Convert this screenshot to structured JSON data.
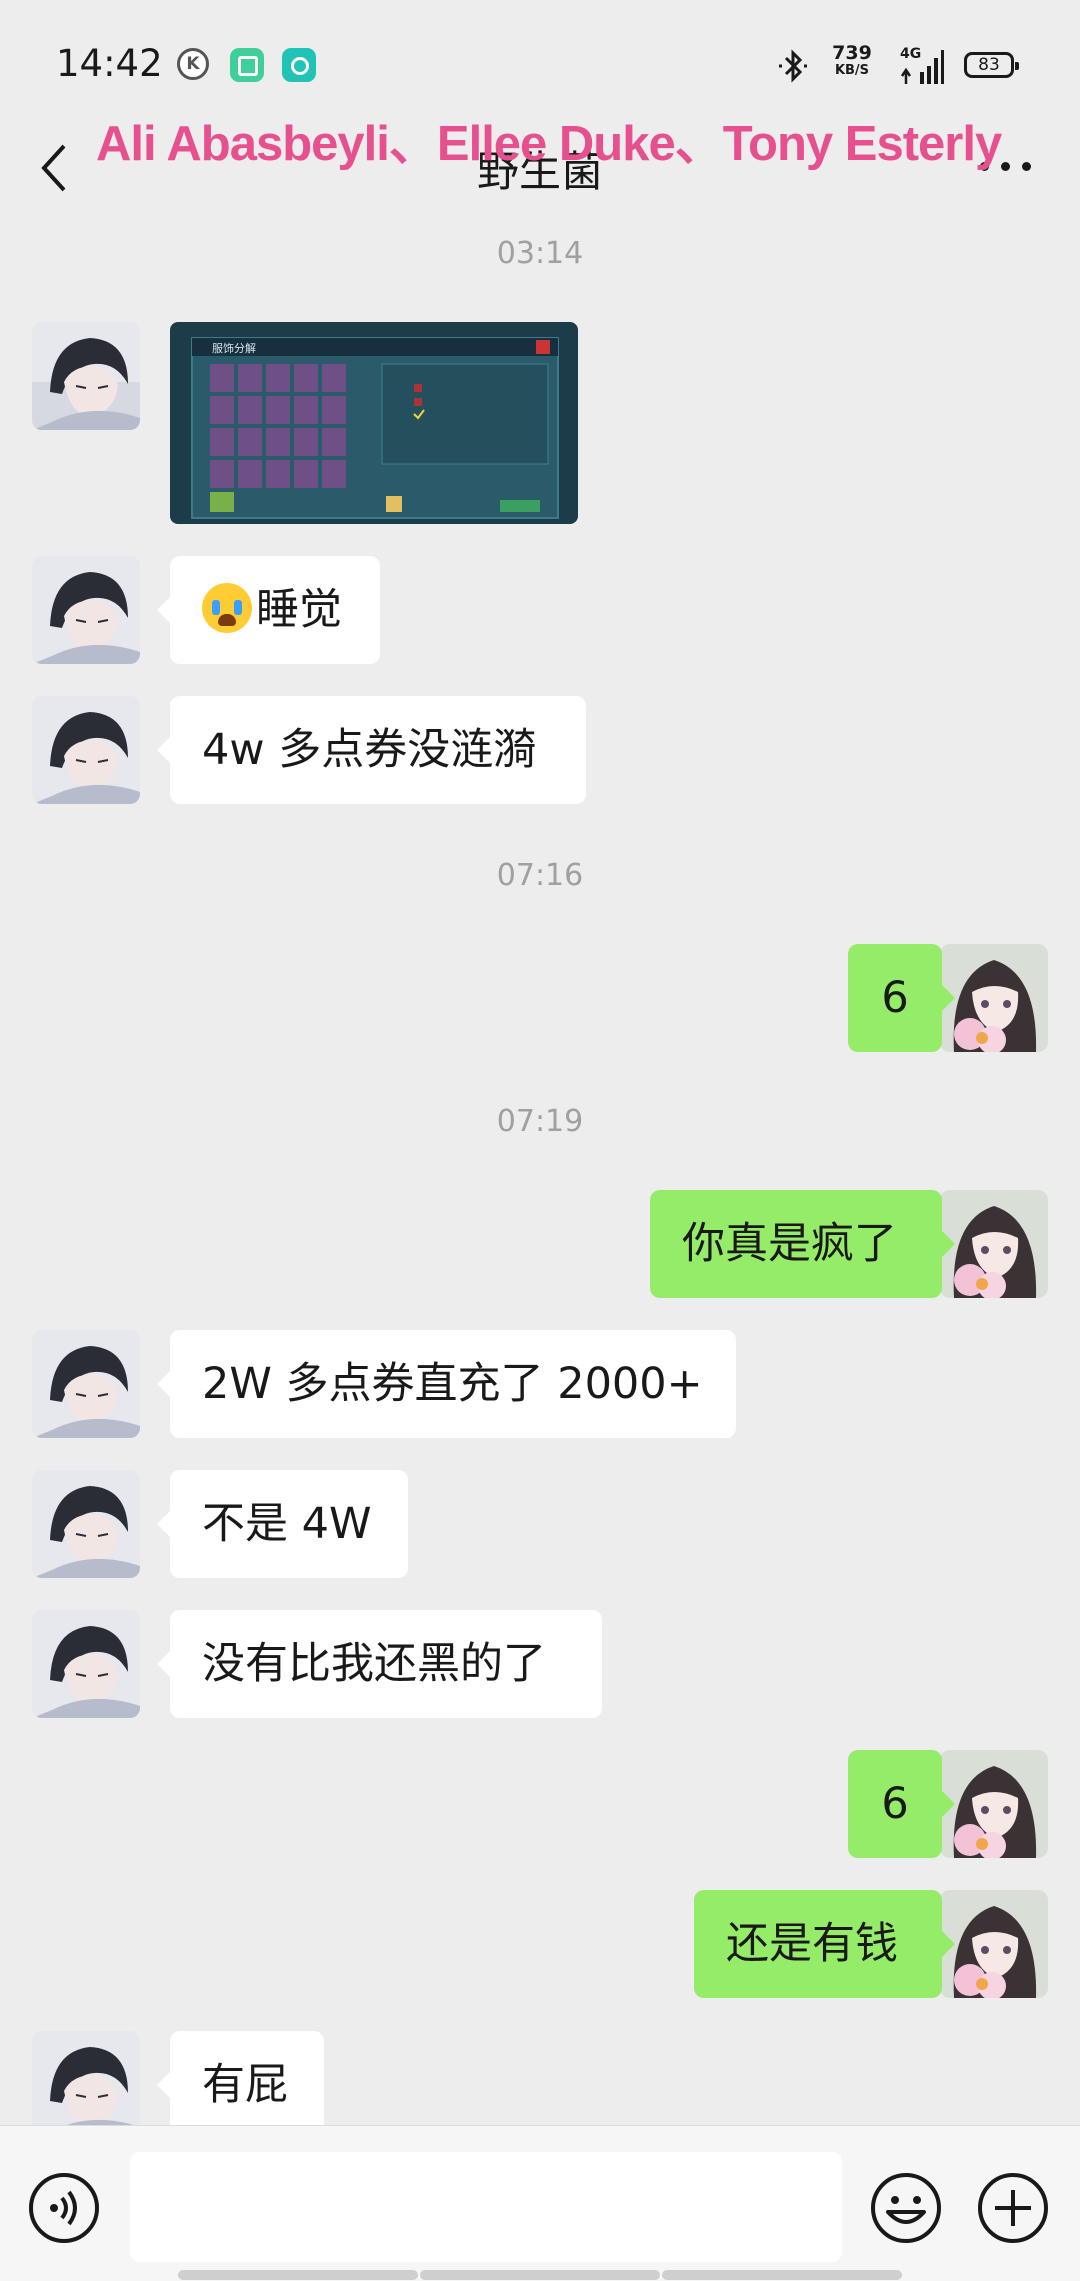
{
  "status_bar": {
    "time": "14:42",
    "app_icons": [
      "k-circle-icon",
      "notification-app-icon",
      "notification-app-icon-2"
    ],
    "net_speed_value": "739",
    "net_speed_unit": "KB/S",
    "network_type": "4G",
    "battery": "83"
  },
  "header": {
    "title": "野生菌",
    "watermark": "Ali Abasbeyli、Ellee Duke、Tony Esterly",
    "back_icon": "chevron-left-icon",
    "more_icon": "more-horizontal-icon"
  },
  "messages": [
    {
      "type": "timestamp",
      "text": "03:14"
    },
    {
      "type": "image",
      "from": "in",
      "caption": "服饰分解"
    },
    {
      "type": "text",
      "from": "in",
      "emoji": "crying-face-emoji",
      "text": "睡觉"
    },
    {
      "type": "text",
      "from": "in",
      "text": "4w 多点券没涟漪"
    },
    {
      "type": "timestamp",
      "text": "07:16"
    },
    {
      "type": "text",
      "from": "out",
      "text": "6"
    },
    {
      "type": "timestamp",
      "text": "07:19"
    },
    {
      "type": "text",
      "from": "out",
      "text": "你真是疯了"
    },
    {
      "type": "text",
      "from": "in",
      "text": "2W 多点券直充了 2000+"
    },
    {
      "type": "text",
      "from": "in",
      "text": "不是 4W"
    },
    {
      "type": "text",
      "from": "in",
      "text": "没有比我还黑的了"
    },
    {
      "type": "text",
      "from": "out",
      "text": "6"
    },
    {
      "type": "text",
      "from": "out",
      "text": "还是有钱"
    },
    {
      "type": "text",
      "from": "in",
      "text": "有屁"
    }
  ],
  "input_bar": {
    "voice_icon": "voice-icon",
    "emoji_icon": "emoji-icon",
    "plus_icon": "plus-icon",
    "input_value": ""
  },
  "colors": {
    "background": "#ededed",
    "outgoing_bubble": "#95ec69",
    "incoming_bubble": "#ffffff",
    "watermark": "#e6508e",
    "timestamp": "#a0a0a0"
  }
}
